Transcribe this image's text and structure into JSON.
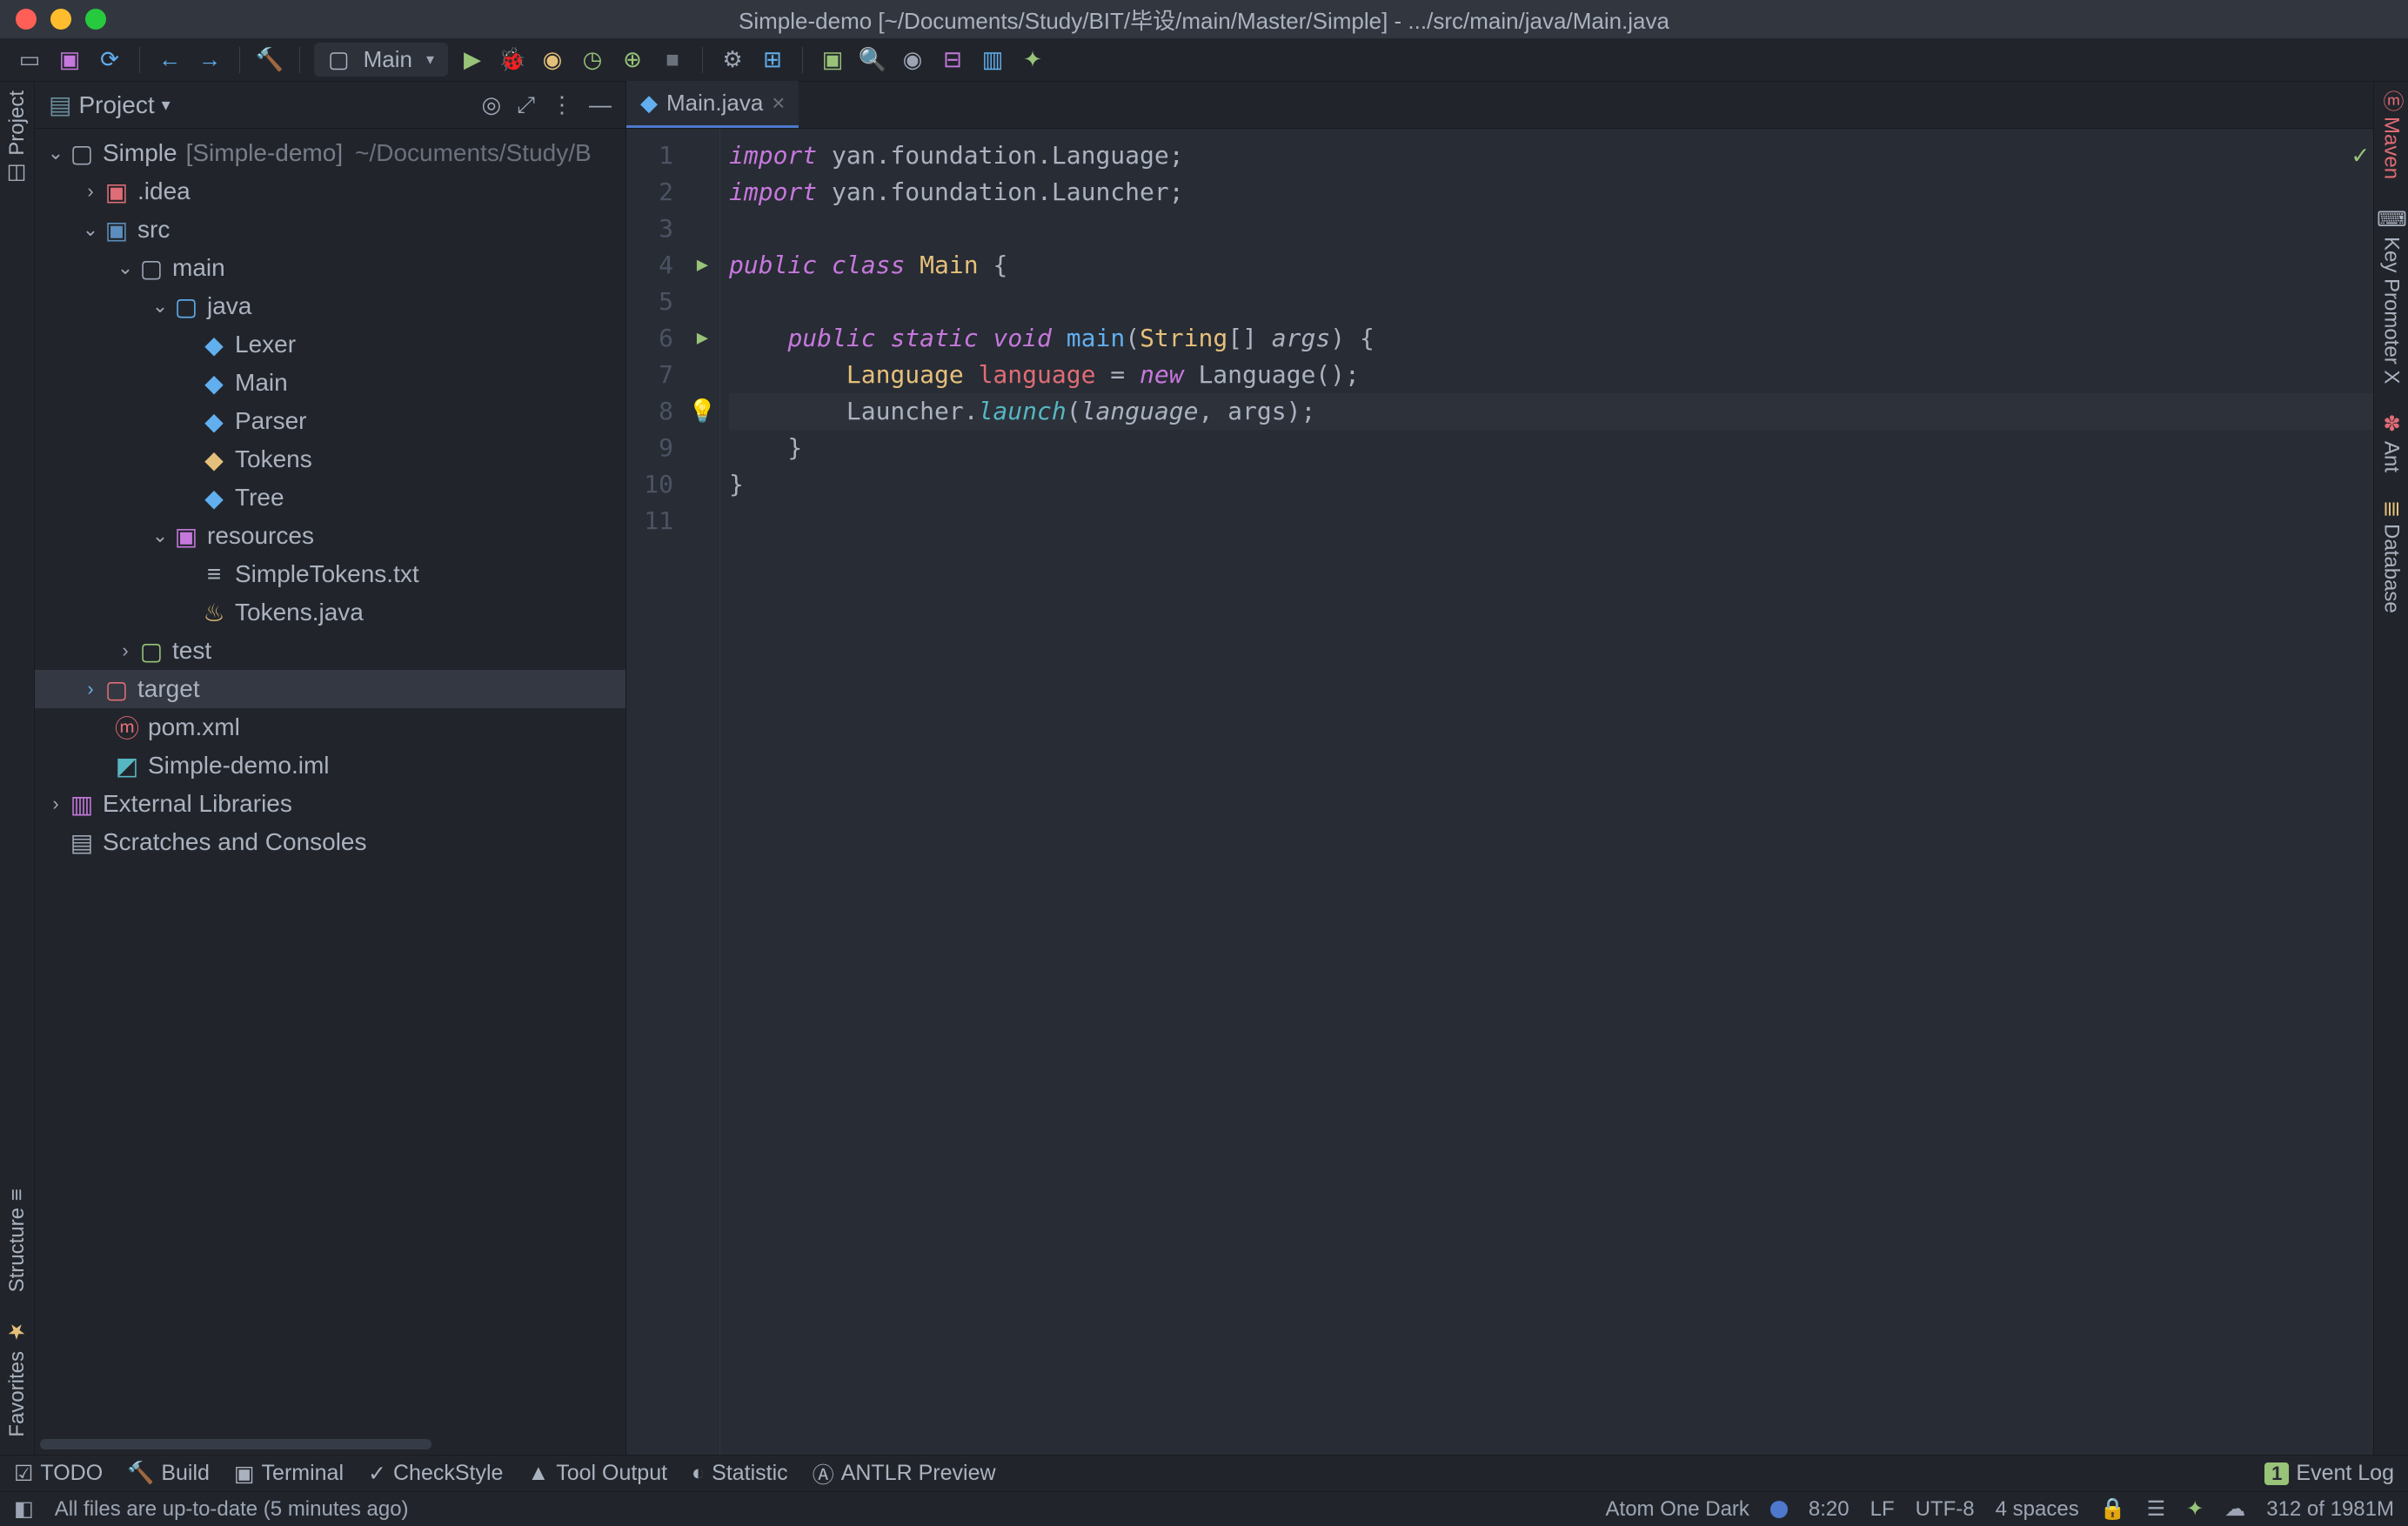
{
  "window": {
    "title": "Simple-demo [~/Documents/Study/BIT/毕设/main/Master/Simple] - .../src/main/java/Main.java"
  },
  "toolbar": {
    "run_config": "Main"
  },
  "project_panel": {
    "title": "Project"
  },
  "tree": {
    "root_name": "Simple",
    "root_bracket": "[Simple-demo]",
    "root_path": "~/Documents/Study/B",
    "idea": ".idea",
    "src": "src",
    "main": "main",
    "java": "java",
    "Lexer": "Lexer",
    "Main": "Main",
    "Parser": "Parser",
    "Tokens": "Tokens",
    "Tree": "Tree",
    "resources": "resources",
    "SimpleTokens": "SimpleTokens.txt",
    "TokensJava": "Tokens.java",
    "test": "test",
    "target": "target",
    "pom": "pom.xml",
    "iml": "Simple-demo.iml",
    "extlib": "External Libraries",
    "scratches": "Scratches and Consoles"
  },
  "tabs": {
    "main": "Main.java"
  },
  "editor": {
    "lines": {
      "n1": "1",
      "n2": "2",
      "n3": "3",
      "n4": "4",
      "n5": "5",
      "n6": "6",
      "n7": "7",
      "n8": "8",
      "n9": "9",
      "n10": "10",
      "n11": "11"
    }
  },
  "code": {
    "import": "import",
    "pkg1": " yan.foundation.Language;",
    "pkg2": " yan.foundation.Launcher;",
    "public": "public",
    "class": "class",
    "Main": "Main",
    "obrace": " {",
    "static": "static",
    "void": "void",
    "mainfn": "main",
    "params_open": "(",
    "String": "String",
    "brackets": "[] ",
    "args": "args",
    "params_close": ") {",
    "LanguageT": "Language",
    "languageV": " language",
    "eq": " = ",
    "newK": "new",
    "LanguageCtor": " Language();",
    "Launcher": "Launcher",
    "dot": ".",
    "launch": "launch",
    "launch_args_open": "(",
    "languageArg": "language",
    "comma_args": ", args);",
    "cbrace1": "    }",
    "cbrace2": "}"
  },
  "left_gutter": {
    "project": "Project",
    "structure": "Structure",
    "favorites": "Favorites"
  },
  "right_gutter": {
    "maven": "Maven",
    "keypromoter": "Key Promoter X",
    "ant": "Ant",
    "database": "Database"
  },
  "bottom": {
    "todo": "TODO",
    "build": "Build",
    "terminal": "Terminal",
    "checkstyle": "CheckStyle",
    "tooloutput": "Tool Output",
    "statistic": "Statistic",
    "antlr": "ANTLR Preview",
    "eventlog": "Event Log",
    "badge1": "1"
  },
  "status": {
    "message": "All files are up-to-date (5 minutes ago)",
    "theme": "Atom One Dark",
    "pos": "8:20",
    "line_sep": "LF",
    "encoding": "UTF-8",
    "indent": "4 spaces",
    "mem": "312 of 1981M"
  }
}
